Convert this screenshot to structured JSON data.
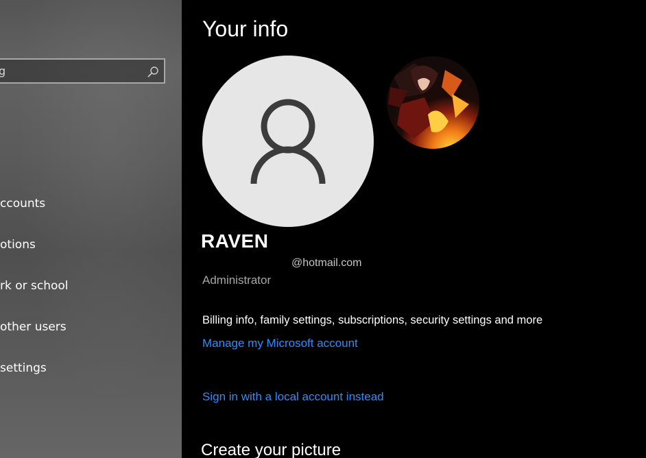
{
  "sidebar": {
    "search": {
      "value": "g"
    },
    "items": [
      {
        "label": "ccounts"
      },
      {
        "label": "otions"
      },
      {
        "label": "rk or school"
      },
      {
        "label": "other users"
      },
      {
        "label": " settings"
      }
    ]
  },
  "main": {
    "title": "Your info",
    "user": {
      "name": "RAVEN",
      "email": "@hotmail.com",
      "role": "Administrator"
    },
    "billing_text": "Billing info, family settings, subscriptions, security settings and more",
    "manage_link": "Manage my Microsoft account",
    "local_account_link": "Sign in with a local account instead",
    "create_picture_title": "Create your picture"
  },
  "icons": {
    "search": "search-icon",
    "default_avatar": "person-icon"
  },
  "colors": {
    "link": "#2d8cff",
    "background": "#000000",
    "avatar_bg": "#e6e6e6"
  }
}
